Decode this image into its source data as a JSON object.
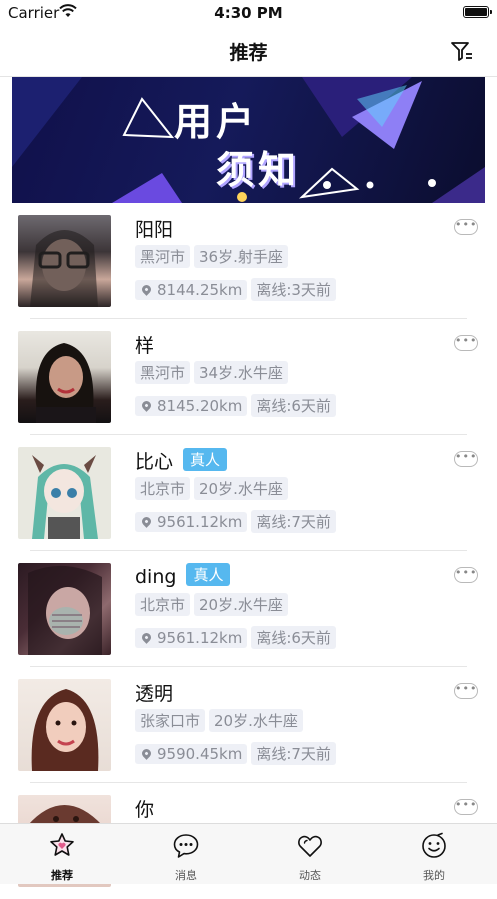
{
  "status_bar": {
    "carrier": "Carrier",
    "time": "4:30 PM"
  },
  "nav": {
    "title": "推荐",
    "filter_icon": "filter-icon"
  },
  "banner": {
    "line1": "用户",
    "line2": "须知"
  },
  "users": [
    {
      "name": "阳阳",
      "city": "黑河市",
      "age_sign": "36岁.射手座",
      "distance": "8144.25km",
      "offline": "离线:3天前"
    },
    {
      "name": "样",
      "city": "黑河市",
      "age_sign": "34岁.水牛座",
      "distance": "8145.20km",
      "offline": "离线:6天前"
    },
    {
      "name": "比心",
      "badge": "真人",
      "city": "北京市",
      "age_sign": "20岁.水牛座",
      "distance": "9561.12km",
      "offline": "离线:7天前"
    },
    {
      "name": "ding",
      "badge": "真人",
      "city": "北京市",
      "age_sign": "20岁.水牛座",
      "distance": "9561.12km",
      "offline": "离线:6天前"
    },
    {
      "name": "透明",
      "city": "张家口市",
      "age_sign": "20岁.水牛座",
      "distance": "9590.45km",
      "offline": "离线:7天前"
    },
    {
      "name": "你"
    }
  ],
  "more_label": "•••",
  "tabs": [
    {
      "label": "推荐",
      "icon": "star-heart-icon",
      "active": true
    },
    {
      "label": "消息",
      "icon": "chat-bubble-icon"
    },
    {
      "label": "动态",
      "icon": "heart-icon"
    },
    {
      "label": "我的",
      "icon": "smiley-icon"
    }
  ],
  "colors": {
    "badge": "#56b8ef",
    "tab_active": "#e25d8c",
    "tag_bg": "#eef0f6"
  }
}
